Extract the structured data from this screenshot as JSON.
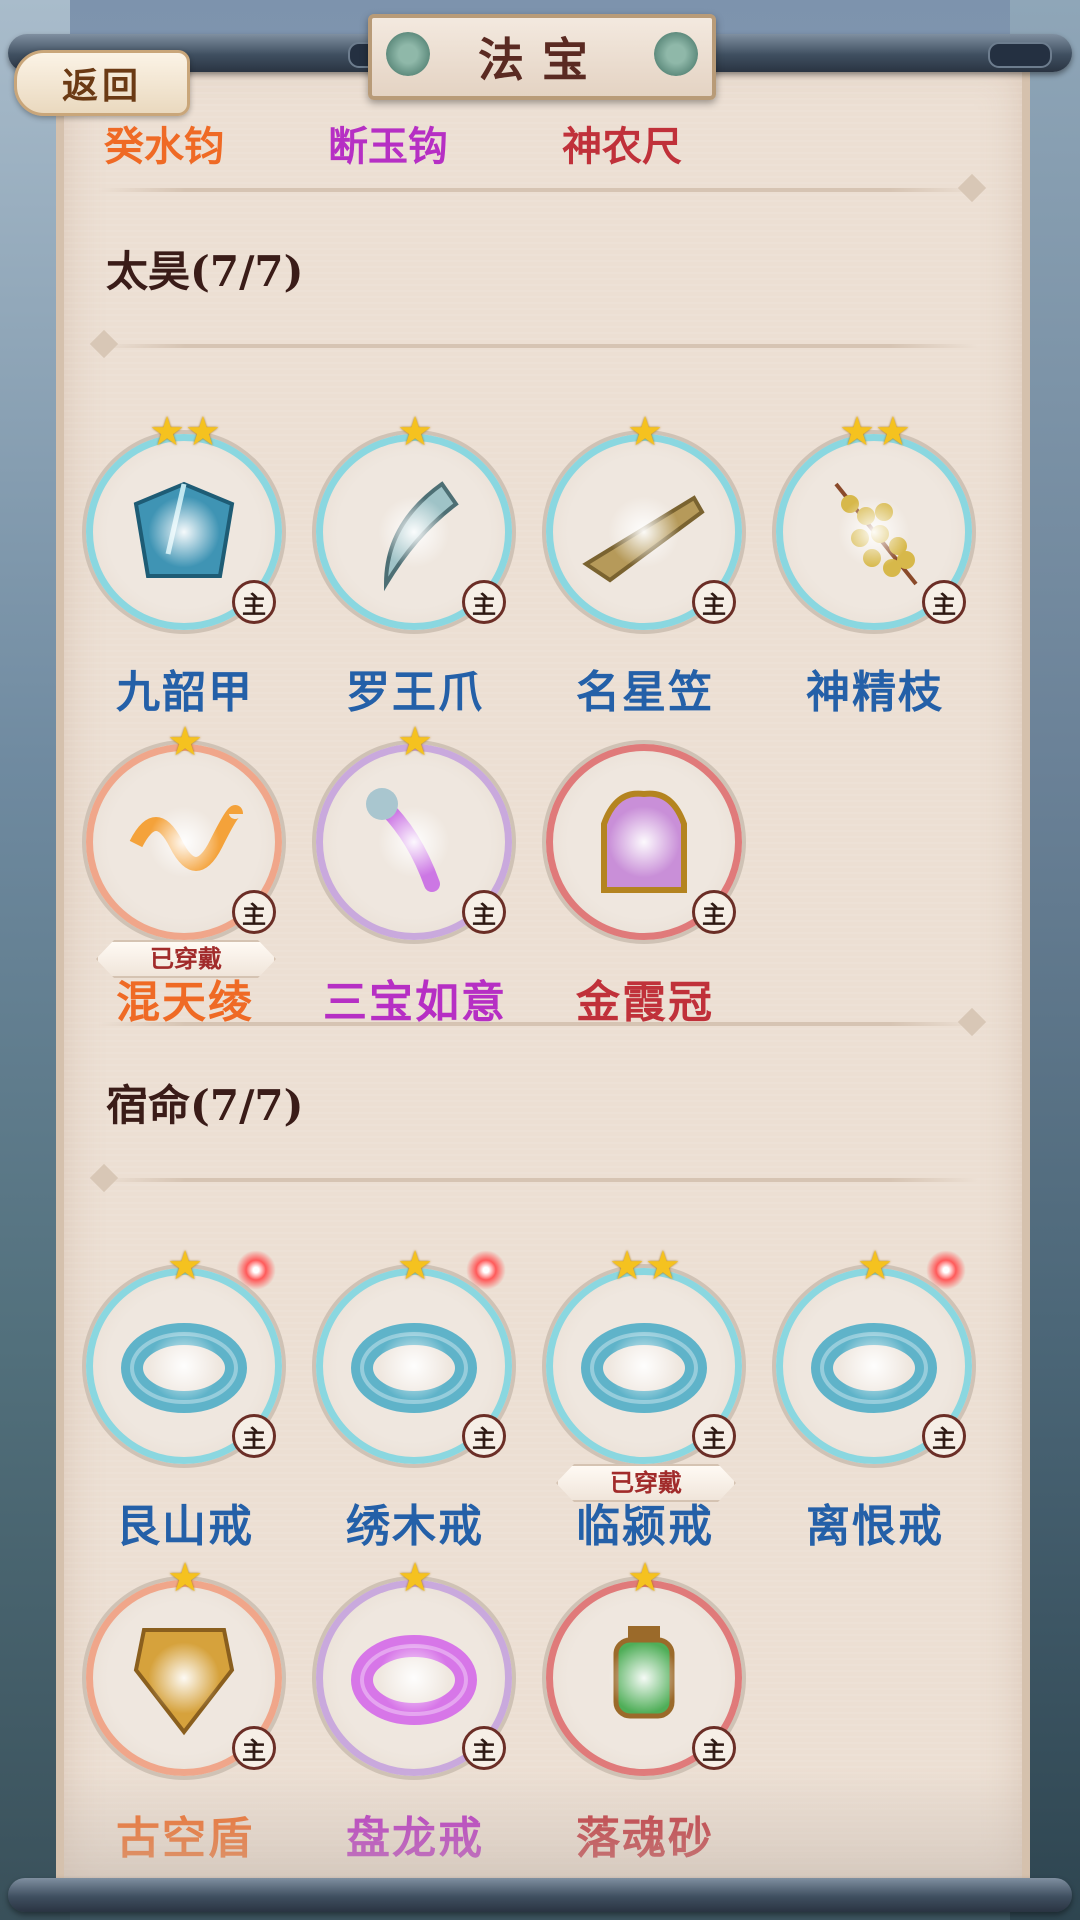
{
  "header": {
    "title": "法宝",
    "back_label": "返回"
  },
  "previous_row": [
    {
      "name": "癸水钧",
      "color": "#ef6a25"
    },
    {
      "name": "断玉钩",
      "color": "#b62fc4"
    },
    {
      "name": "神农尺",
      "color": "#c0313a"
    }
  ],
  "sections": [
    {
      "title": "太昊(7/7)",
      "items": [
        {
          "name": "九韶甲",
          "stars": "★★",
          "rarity": "blue",
          "badge": "主",
          "equipped": false,
          "icon": "robe-icon"
        },
        {
          "name": "罗王爪",
          "stars": "★",
          "rarity": "blue",
          "badge": "主",
          "equipped": false,
          "icon": "claw-icon"
        },
        {
          "name": "名星笠",
          "stars": "★",
          "rarity": "blue",
          "badge": "主",
          "equipped": false,
          "icon": "straw-hat-icon"
        },
        {
          "name": "神精枝",
          "stars": "★★",
          "rarity": "blue",
          "badge": "主",
          "equipped": false,
          "icon": "fruit-branch-icon"
        },
        {
          "name": "混天绫",
          "stars": "★",
          "rarity": "orange",
          "badge": "主",
          "equipped": true,
          "equipped_label": "已穿戴",
          "icon": "silk-ribbon-icon"
        },
        {
          "name": "三宝如意",
          "stars": "★",
          "rarity": "purple",
          "badge": "主",
          "equipped": false,
          "icon": "ruyi-scepter-icon"
        },
        {
          "name": "金霞冠",
          "stars": "",
          "rarity": "red",
          "badge": "主",
          "equipped": false,
          "icon": "crown-icon"
        }
      ]
    },
    {
      "title": "宿命(7/7)",
      "items": [
        {
          "name": "艮山戒",
          "stars": "★",
          "rarity": "blue",
          "badge": "主",
          "equipped": false,
          "spark": true,
          "icon": "purple-ring-icon"
        },
        {
          "name": "绣木戒",
          "stars": "★",
          "rarity": "blue",
          "badge": "主",
          "equipped": false,
          "spark": true,
          "icon": "jade-ring-icon"
        },
        {
          "name": "临颍戒",
          "stars": "★★",
          "rarity": "blue",
          "badge": "主",
          "equipped": true,
          "equipped_label": "已穿戴",
          "icon": "gold-ring-icon"
        },
        {
          "name": "离恨戒",
          "stars": "★",
          "rarity": "blue",
          "badge": "主",
          "equipped": false,
          "spark": true,
          "icon": "green-bangle-icon"
        },
        {
          "name": "古空盾",
          "stars": "★",
          "rarity": "orange",
          "badge": "主",
          "equipped": false,
          "icon": "shield-icon"
        },
        {
          "name": "盘龙戒",
          "stars": "★",
          "rarity": "purple",
          "badge": "主",
          "equipped": false,
          "icon": "winged-ring-icon"
        },
        {
          "name": "落魂砂",
          "stars": "★",
          "rarity": "red",
          "badge": "主",
          "equipped": false,
          "icon": "lantern-icon"
        }
      ]
    }
  ],
  "colors": {
    "blue": "#2460a8",
    "orange": "#ef6a25",
    "purple": "#b62fc4",
    "red": "#c0313a",
    "star": "#f5c21f"
  }
}
